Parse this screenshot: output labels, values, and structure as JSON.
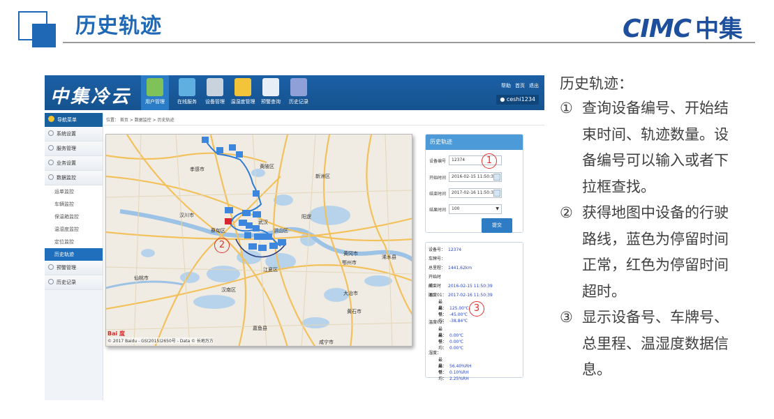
{
  "slide": {
    "title": "历史轨迹",
    "logo_en": "CIMC",
    "logo_cn": "中集"
  },
  "app": {
    "logo": "中集冷云",
    "nav": [
      {
        "label": "用户管理",
        "icon": "users-icon",
        "active": true
      },
      {
        "label": "在线服务",
        "icon": "document-icon",
        "active": false
      },
      {
        "label": "设备管理",
        "icon": "gear-icon",
        "active": false
      },
      {
        "label": "温湿度管理",
        "icon": "sliders-icon",
        "active": false
      },
      {
        "label": "预警查询",
        "icon": "alert-doc-icon",
        "active": false
      },
      {
        "label": "历史记录",
        "icon": "clock-icon",
        "active": false
      }
    ],
    "top_links": [
      "帮助",
      "首页",
      "退出"
    ],
    "user": "ceshi1234",
    "sidebar": {
      "header": "导航菜单",
      "items_top": [
        "系统设置",
        "服务管理",
        "业务设置",
        "数据监控"
      ],
      "sub_items": [
        {
          "label": "运单监控",
          "active": false
        },
        {
          "label": "车辆监控",
          "active": false
        },
        {
          "label": "保温箱监控",
          "active": false
        },
        {
          "label": "温湿度监控",
          "active": false
        },
        {
          "label": "定位监控",
          "active": false
        },
        {
          "label": "历史轨迹",
          "active": true
        }
      ],
      "items_bottom": [
        "预警管理",
        "历史记录"
      ]
    },
    "breadcrumb": "位置： 首页 > 数据监控 > 历史轨迹",
    "map": {
      "copyright": "© 2017 Baidu - GS(2015)2650号 - Data © 长地万方",
      "baidu": "Bai 度",
      "places": [
        "孝感市",
        "黄陂区",
        "新洲区",
        "汉川市",
        "蔡甸区",
        "武汉",
        "洪山区",
        "鄂州市",
        "黄冈市",
        "江夏区",
        "仙桃市",
        "黄石市",
        "咸宁市",
        "浠水县",
        "阳逻",
        "汉南区",
        "嘉鱼县",
        "大冶市"
      ]
    },
    "query": {
      "title": "历史轨迹",
      "device_label": "设备编号",
      "device_value": "12374",
      "start_label": "开始时间",
      "start_value": "2016-02-15 11:50:39",
      "end_label": "结束时间",
      "end_value": "2017-02-16 11:50:39",
      "count_label": "结果时间",
      "count_value": "100",
      "submit": "提交"
    },
    "info": {
      "device_label": "设备号：",
      "device_value": "12374",
      "plate_label": "车牌号：",
      "plate_value": "",
      "mileage_label": "总里程：",
      "mileage_value": "1441.62km",
      "start_label": "开始时间：",
      "start_value": "2016-02-15 11:50:39",
      "end_label": "结束时间：",
      "end_value": "2017-02-16 11:50:39",
      "temp1_label": "温度01：",
      "temp1": {
        "max": "125.00℃",
        "min": "-45.00℃",
        "avg": "-38.84℃"
      },
      "temp2_label": "温度02：",
      "temp2": {
        "max": "0.00℃",
        "min": "0.00℃",
        "avg": "0.00℃"
      },
      "hum_label": "湿度：",
      "hum": {
        "max": "56.40%RH",
        "min": "0.10%RH",
        "avg": "2.25%RH"
      },
      "max_label": "最高：",
      "min_label": "最低：",
      "avg_label": "平均："
    },
    "markers": [
      "1",
      "2",
      "3"
    ],
    "colors": {
      "header": "#1b5fa5",
      "route_blue": "#2b7ad6",
      "route_red": "#d7262f",
      "accent": "#1f68b5"
    }
  },
  "desc": {
    "title": "历史轨迹：",
    "items": [
      {
        "num": "①",
        "text": "查询设备编号、开始结束时间、轨迹数量。设备编号可以输入或者下拉框查找。"
      },
      {
        "num": "②",
        "text": "获得地图中设备的行驶路线，蓝色为停留时间正常，红色为停留时间超时。"
      },
      {
        "num": "③",
        "text": "显示设备号、车牌号、总里程、温湿度数据信息。"
      }
    ]
  }
}
